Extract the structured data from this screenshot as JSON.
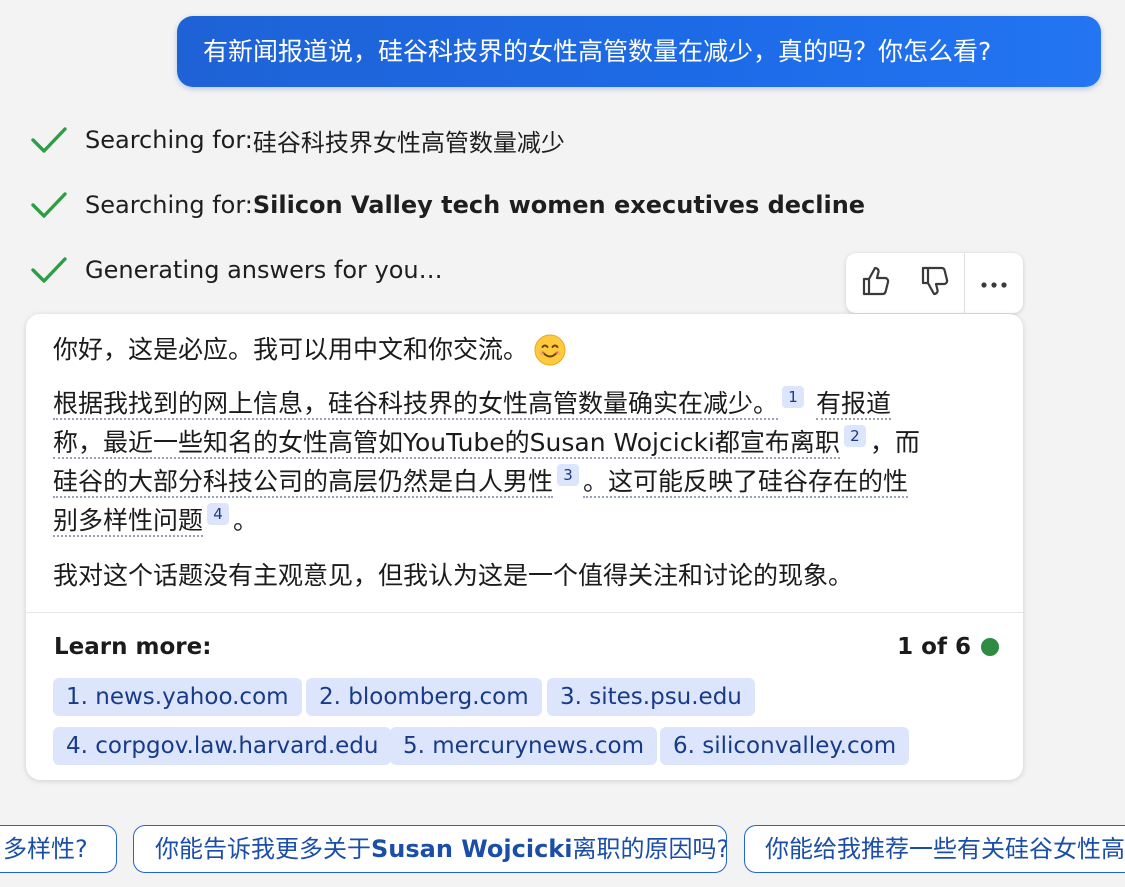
{
  "user_message": "有新闻报道说，硅谷科技界的女性高管数量在减少，真的吗？你怎么看?",
  "progress": [
    {
      "prefix": "Searching for: ",
      "query": "硅谷科技界女性高管数量减少",
      "bold": false
    },
    {
      "prefix": "Searching for: ",
      "query": "Silicon Valley tech women executives decline",
      "bold": true
    },
    {
      "prefix": "Generating answers for you…",
      "query": "",
      "bold": false
    }
  ],
  "feedback": {
    "thumbs_up": "thumbs-up-icon",
    "thumbs_down": "thumbs-down-icon",
    "more": "more-horizontal-icon"
  },
  "response": {
    "greeting": "你好，这是必应。我可以用中文和你交流。",
    "emoji": "smiling-face-emoji",
    "p2_line1_a": "根据我找到的网上信息，硅谷科技界的女性高管数量确实在减少。",
    "p2_line1_b": "有报道",
    "p2_line2_a": "称，最近一些知名的女性高管如YouTube的Susan Wojcicki都宣布离职",
    "p2_line2_b": "，而",
    "p2_line3_a": "硅谷的大部分科技公司的高层仍然是白人男性",
    "p2_line3_b": "。这可能反映了硅谷存在的性",
    "p2_line4_a": "别多样性问题",
    "p2_line4_b": "。",
    "cite_1": "1",
    "cite_2": "2",
    "cite_3": "3",
    "cite_4": "4",
    "p3": "我对这个话题没有主观意见，但我认为这是一个值得关注和讨论的现象。"
  },
  "learn_more": {
    "label": "Learn more:",
    "page": "1 of 6",
    "sources": [
      "1. news.yahoo.com",
      "2. bloomberg.com",
      "3. sites.psu.edu",
      "4. corpgov.law.harvard.edu",
      "5. mercurynews.com",
      "6. siliconvalley.com"
    ]
  },
  "suggestions": {
    "s1": "多样性?",
    "s2_a": "你能告诉我更多关于",
    "s2_b": "Susan Wojcicki",
    "s2_c": "离职的原因吗?",
    "s3": "你能给我推荐一些有关硅谷女性高管"
  },
  "colors": {
    "user_bubble": "#1d6be8",
    "check": "#2e9e45",
    "source_chip_bg": "#dce5fb",
    "source_chip_text": "#173b87",
    "page_dot": "#2f8a44",
    "suggestion_border": "#2164d6"
  }
}
